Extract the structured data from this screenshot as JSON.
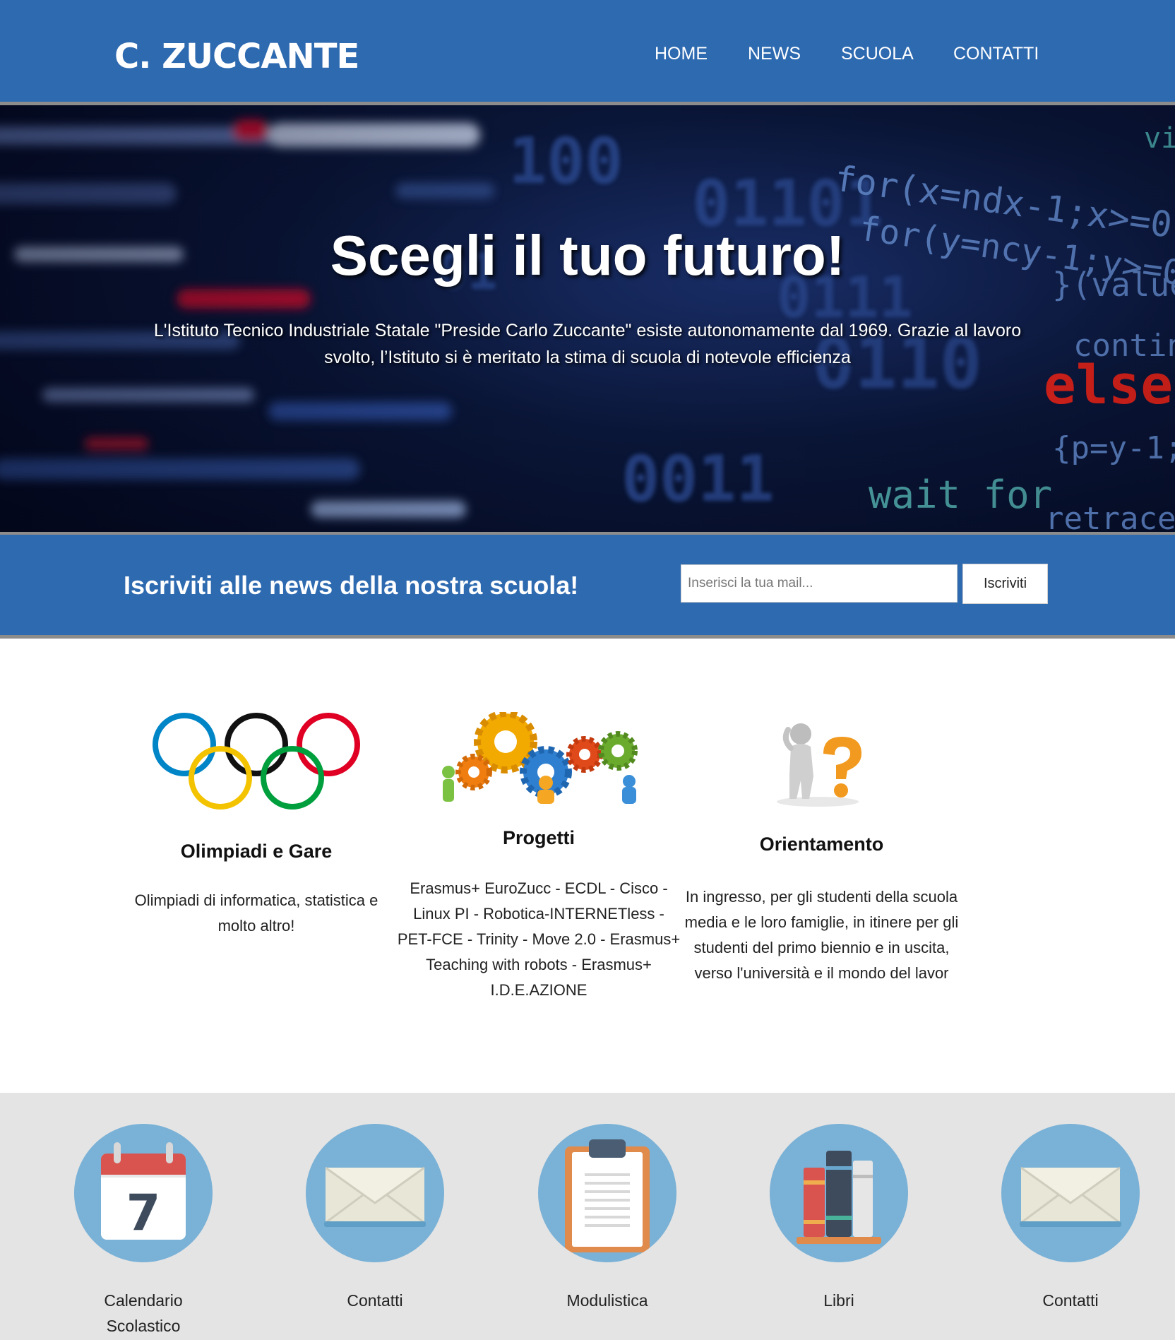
{
  "header": {
    "logo": "C. ZUCCANTE",
    "nav": [
      {
        "label": "HOME"
      },
      {
        "label": "NEWS"
      },
      {
        "label": "SCUOLA"
      },
      {
        "label": "CONTATTI"
      }
    ]
  },
  "hero": {
    "title": "Scegli il tuo futuro!",
    "text": "L'Istituto Tecnico Industriale Statale \"Preside Carlo Zuccante\" esiste autonomamente dal 1969. Grazie al lavoro svolto, l’Istituto si è meritato la stima di scuola di notevole efficienza"
  },
  "newsletter": {
    "title": "Iscriviti alle news della nostra scuola!",
    "placeholder": "Inserisci la tua mail...",
    "button": "Iscriviti"
  },
  "features": [
    {
      "title": "Olimpiadi e Gare",
      "text": "Olimpiadi di informatica, statistica e molto altro!",
      "icon": "olympic-rings-icon"
    },
    {
      "title": "Progetti",
      "text": "Erasmus+ EuroZucc - ECDL - Cisco - Linux PI - Robotica-INTERNETless - PET-FCE - Trinity - Move 2.0 - Erasmus+ Teaching with robots - Erasmus+ I.D.E.AZIONE",
      "icon": "gears-icon"
    },
    {
      "title": "Orientamento",
      "text": "In ingresso, per gli studenti della scuola media e le loro famiglie, in itinere per gli studenti del primo biennio e in uscita, verso l'università e il mondo del lavor",
      "icon": "question-person-icon"
    }
  ],
  "links": [
    {
      "label": "Calendario Scolastico",
      "icon": "calendar-icon",
      "calendar_day": "7"
    },
    {
      "label": "Contatti",
      "icon": "envelope-icon"
    },
    {
      "label": "Modulistica",
      "icon": "clipboard-icon"
    },
    {
      "label": "Libri",
      "icon": "books-icon"
    },
    {
      "label": "Contatti",
      "icon": "envelope-icon"
    }
  ],
  "colors": {
    "primary": "#2e6ab0",
    "divider": "#8c8c8c",
    "link_circle": "#7ab1d6",
    "links_background": "#e4e4e4"
  }
}
